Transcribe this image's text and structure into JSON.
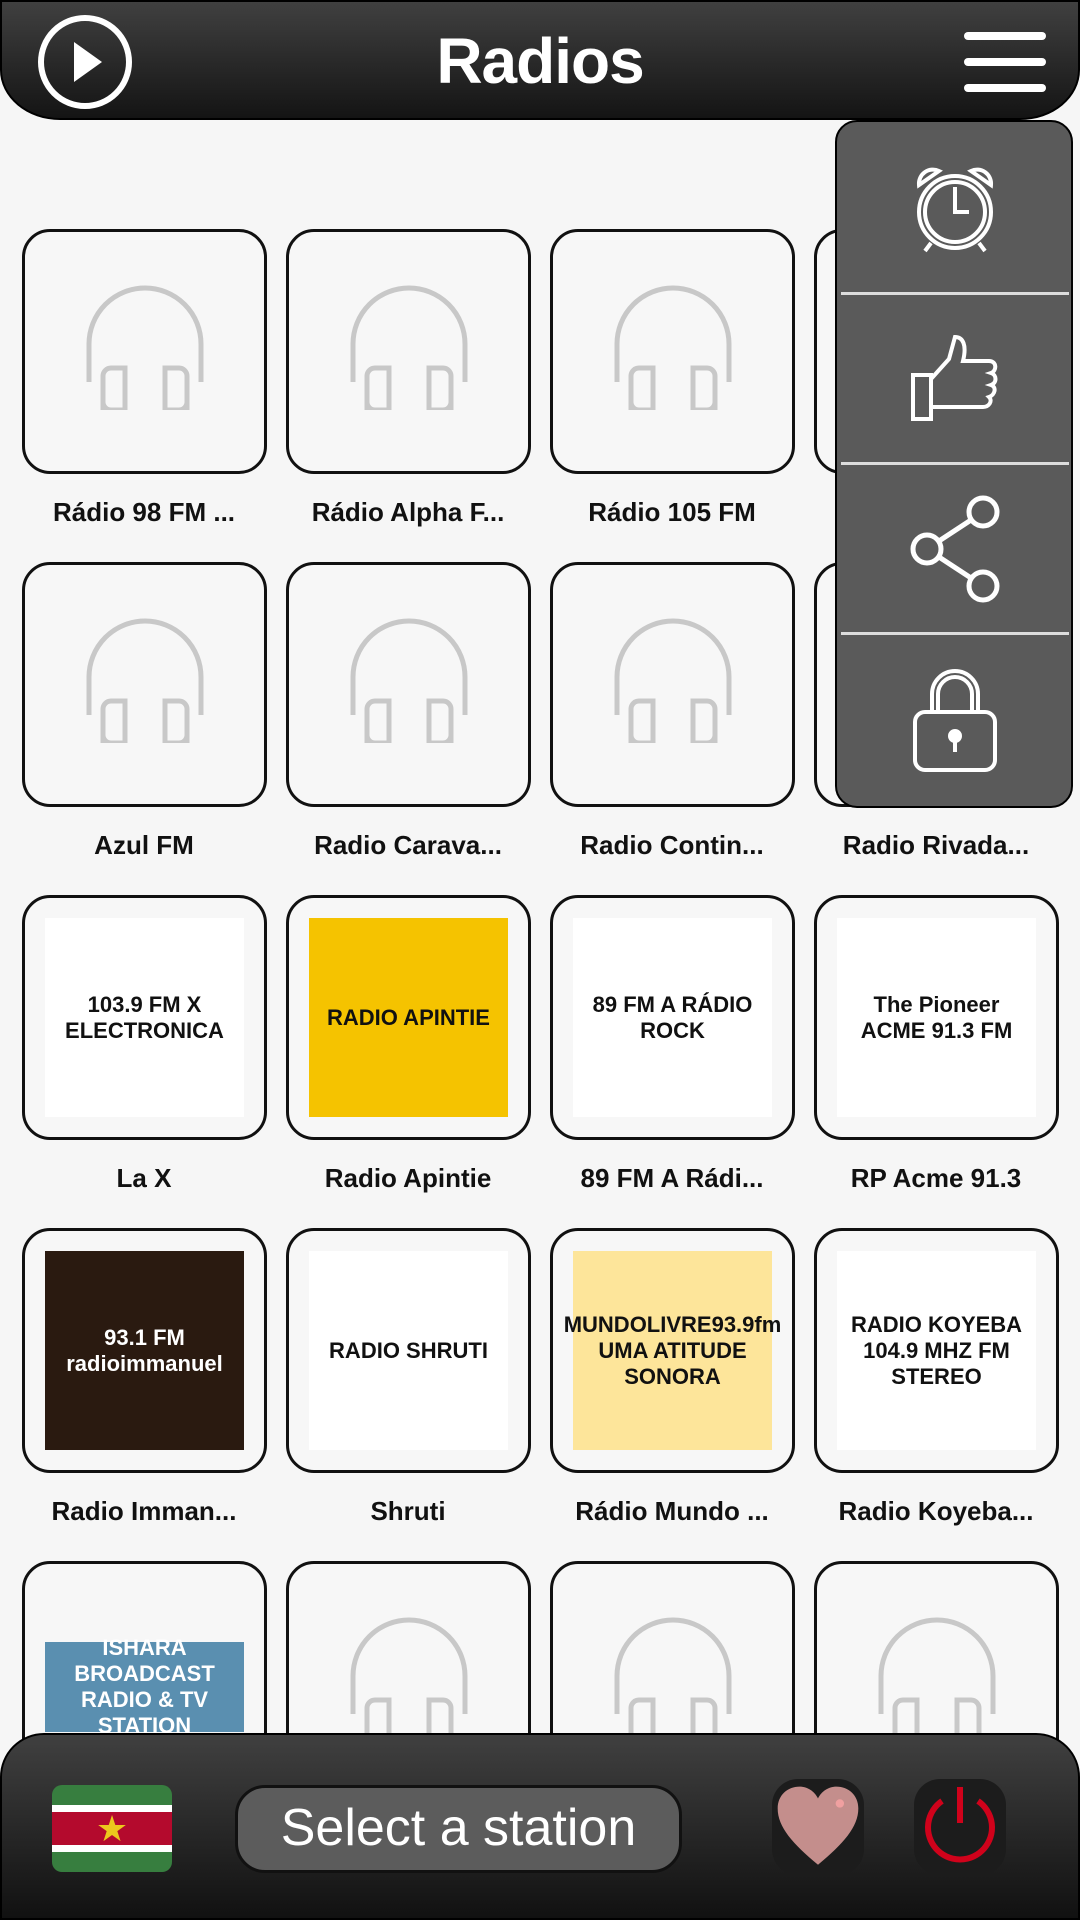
{
  "header": {
    "title": "Radios",
    "play_icon": "play-circle-icon",
    "menu_icon": "hamburger-menu-icon"
  },
  "popup_menu": [
    {
      "icon": "alarm-clock-icon"
    },
    {
      "icon": "thumbs-up-icon"
    },
    {
      "icon": "share-icon"
    },
    {
      "icon": "lock-icon"
    }
  ],
  "stations": [
    {
      "name": "Rádio 98 FM ...",
      "logo": null
    },
    {
      "name": "Rádio Alpha F...",
      "logo": null
    },
    {
      "name": "Rádio 105 FM",
      "logo": null
    },
    {
      "name": "",
      "logo": null
    },
    {
      "name": "Azul FM",
      "logo": null
    },
    {
      "name": "Radio Carava...",
      "logo": null
    },
    {
      "name": "Radio Contin...",
      "logo": null
    },
    {
      "name": "Radio Rivada...",
      "logo": null
    },
    {
      "name": "La X",
      "logo": {
        "text": "103.9 FM X ELECTRONICA",
        "bg": "#ffffff"
      }
    },
    {
      "name": "Radio Apintie",
      "logo": {
        "text": "RADIO APINTIE",
        "bg": "#f5c300"
      }
    },
    {
      "name": "89 FM A Rádi...",
      "logo": {
        "text": "89 FM A RÁDIO ROCK",
        "bg": "#ffffff"
      }
    },
    {
      "name": "RP Acme 91.3",
      "logo": {
        "text": "The Pioneer ACME 91.3 FM",
        "bg": "#ffffff"
      }
    },
    {
      "name": "Radio Imman...",
      "logo": {
        "text": "93.1 FM radioimmanuel",
        "bg": "#2a1a10"
      }
    },
    {
      "name": "Shruti",
      "logo": {
        "text": "RADIO SHRUTI",
        "bg": "#ffffff"
      }
    },
    {
      "name": "Rádio Mundo ...",
      "logo": {
        "text": "MUNDOLIVRE93.9fm UMA ATITUDE SONORA",
        "bg": "#fde59a"
      }
    },
    {
      "name": "Radio Koyeba...",
      "logo": {
        "text": "RADIO KOYEBA 104.9 MHZ FM STEREO",
        "bg": "#ffffff"
      }
    },
    {
      "name": "",
      "logo": {
        "text": "ISHARA BROADCAST RADIO & TV STATION",
        "bg": "#5a8fb0"
      }
    },
    {
      "name": "",
      "logo": null
    },
    {
      "name": "",
      "logo": null
    },
    {
      "name": "",
      "logo": null
    }
  ],
  "player": {
    "flag": "Suriname",
    "status": "Select a station",
    "favorite_icon": "heart-icon",
    "power_icon": "power-icon"
  },
  "colors": {
    "header": "#1a1a1a",
    "popup": "#5a5a5a",
    "power": "#d0021b",
    "heart": "#c48e8c"
  }
}
